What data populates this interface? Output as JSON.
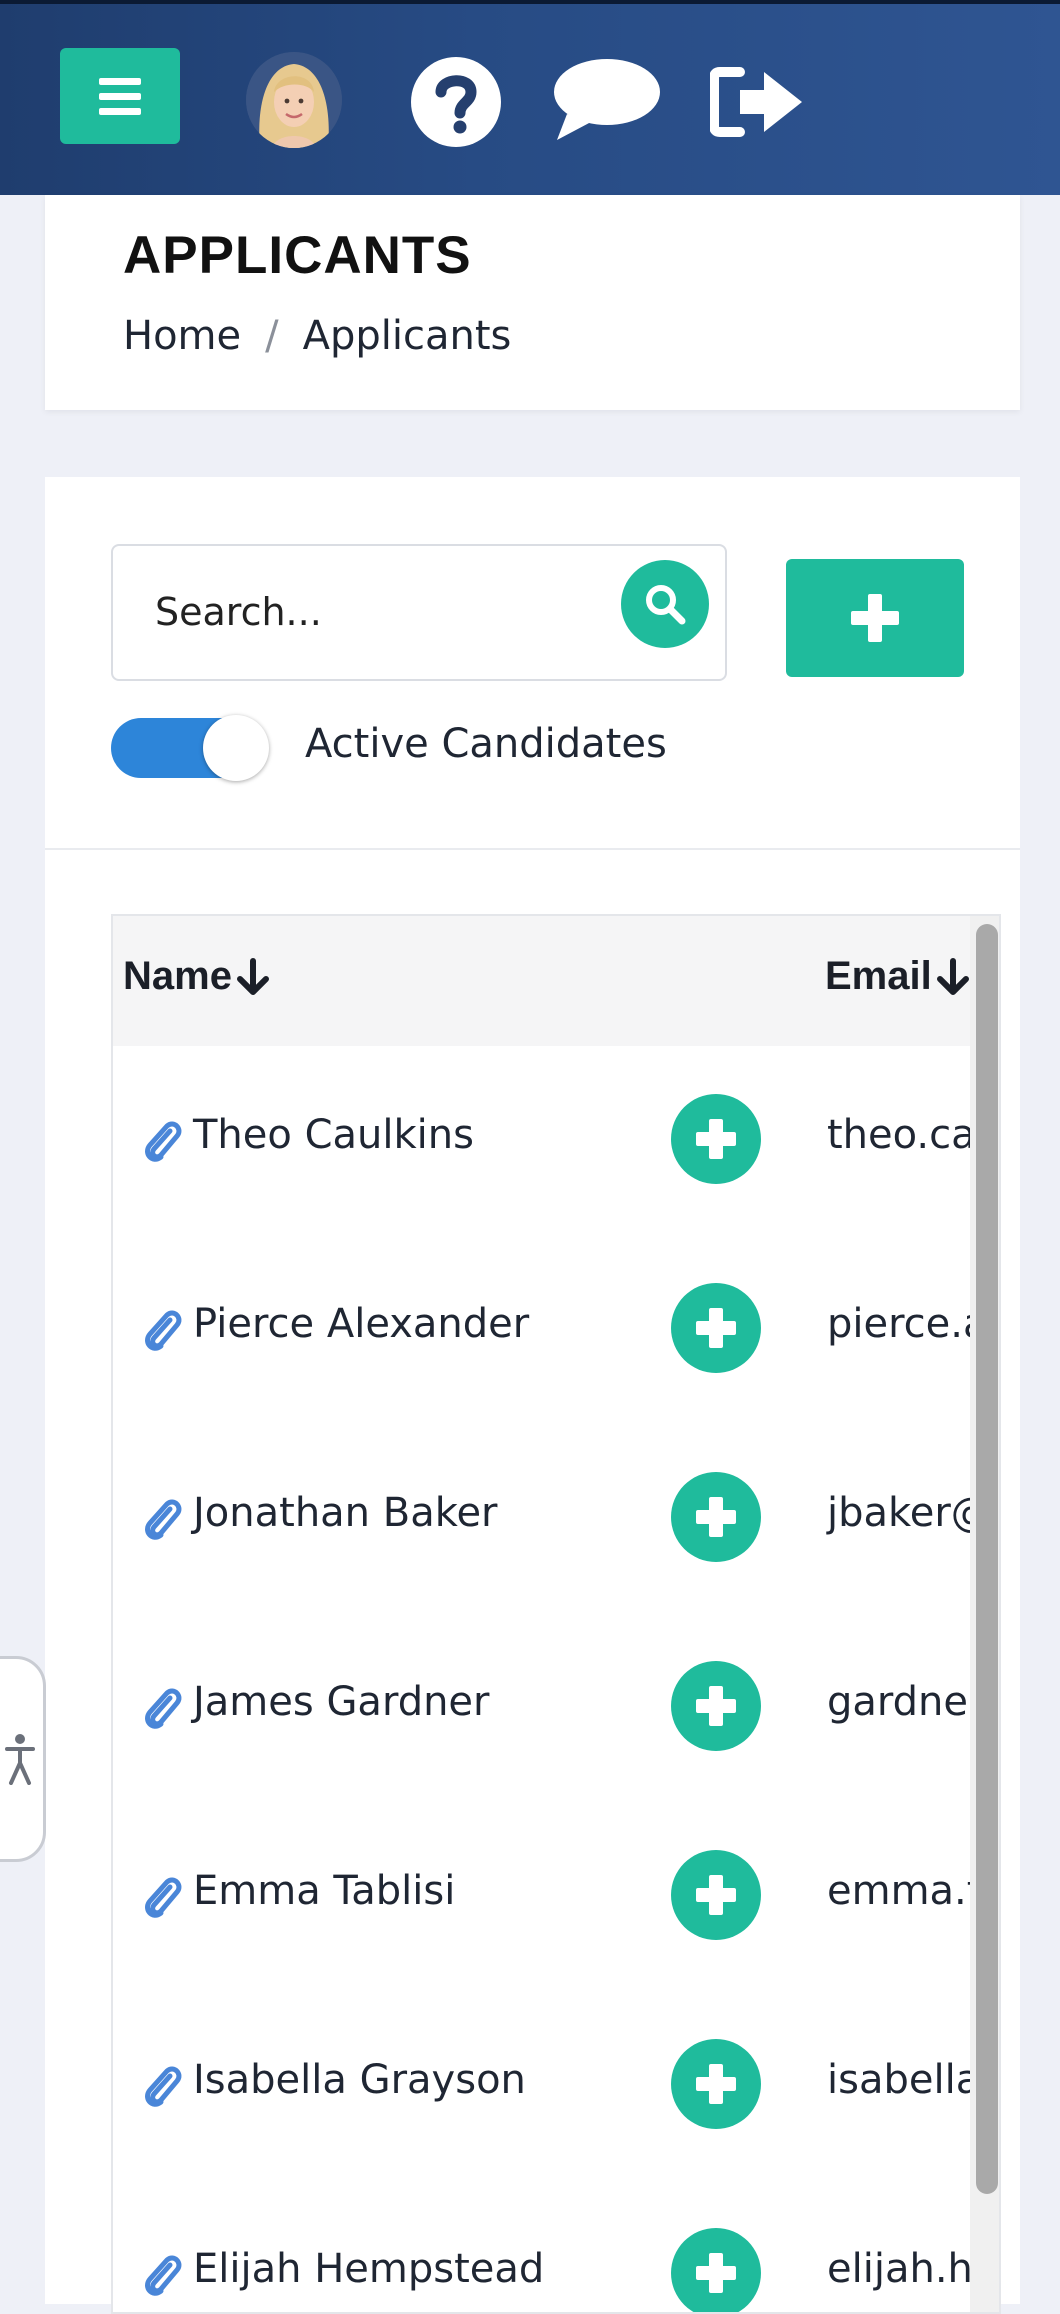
{
  "topbar": {
    "menu_icon": "hamburger-menu-icon",
    "avatar_icon": "user-avatar",
    "help_icon": "question-circle-icon",
    "chat_icon": "chat-bubble-icon",
    "logout_icon": "sign-out-icon"
  },
  "header": {
    "title": "APPLICANTS",
    "breadcrumb": [
      {
        "label": "Home"
      },
      {
        "label": "Applicants"
      }
    ],
    "breadcrumb_separator": "/"
  },
  "filters": {
    "search_placeholder": "Search...",
    "search_value": "",
    "toggle_label": "Active Candidates",
    "toggle_on": true
  },
  "table": {
    "columns": [
      "Name",
      "Email"
    ],
    "rows": [
      {
        "name": "Theo Caulkins",
        "email": "theo.cau"
      },
      {
        "name": "Pierce Alexander",
        "email": "pierce.a"
      },
      {
        "name": "Jonathan Baker",
        "email": "jbaker@"
      },
      {
        "name": "James Gardner",
        "email": "gardner"
      },
      {
        "name": "Emma Tablisi",
        "email": "emma.t"
      },
      {
        "name": "Isabella Grayson",
        "email": "isabella."
      },
      {
        "name": "Elijah Hempstead",
        "email": "elijah.he"
      }
    ]
  },
  "colors": {
    "accent": "#1fbb9c",
    "header_bg": "#274b84",
    "toggle_on": "#2d85d9",
    "paperclip": "#4a86d8"
  }
}
